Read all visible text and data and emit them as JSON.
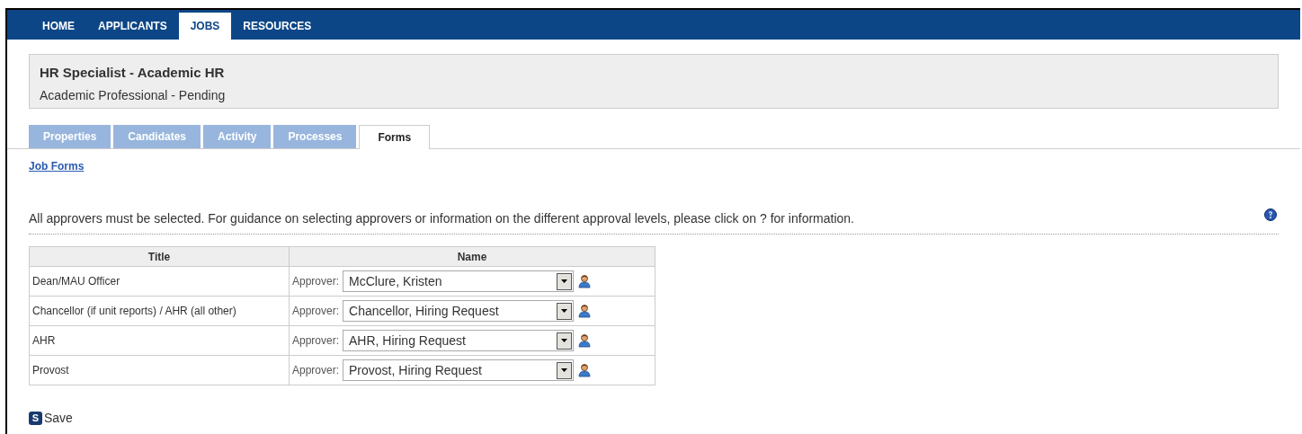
{
  "nav": [
    {
      "label": "HOME",
      "selected": false
    },
    {
      "label": "APPLICANTS",
      "selected": false
    },
    {
      "label": "JOBS",
      "selected": true
    },
    {
      "label": "RESOURCES",
      "selected": false
    }
  ],
  "job": {
    "title": "HR Specialist - Academic HR",
    "subtitle": "Academic Professional - Pending"
  },
  "tabs": [
    {
      "label": "Properties",
      "selected": false
    },
    {
      "label": "Candidates",
      "selected": false
    },
    {
      "label": "Activity",
      "selected": false
    },
    {
      "label": "Processes",
      "selected": false
    },
    {
      "label": "Forms",
      "selected": true
    }
  ],
  "breadcrumb": "Job Forms",
  "instructions": "All approvers must be selected. For guidance on selecting approvers or information on the different approval levels, please click on ? for information.",
  "table": {
    "columns": [
      "Title",
      "Name"
    ],
    "rows": [
      {
        "title": "Dean/MAU Officer",
        "label": "Approver:",
        "value": "McClure, Kristen"
      },
      {
        "title": "Chancellor (if unit reports) / AHR (all other)",
        "label": "Approver:",
        "value": "Chancellor, Hiring Request"
      },
      {
        "title": "AHR",
        "label": "Approver:",
        "value": "AHR, Hiring Request"
      },
      {
        "title": "Provost",
        "label": "Approver:",
        "value": "Provost, Hiring Request"
      }
    ]
  },
  "save": {
    "key": "S",
    "label": "Save"
  }
}
